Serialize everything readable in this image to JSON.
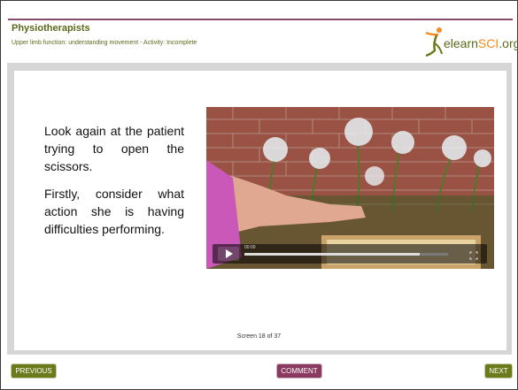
{
  "header": {
    "course_title": "Physiotherapists",
    "module_line": "Upper limb function: understanding movement - Activity: Incomplete",
    "logo": {
      "text_main": "elearn",
      "text_accent": "SCI",
      "text_suffix": ".org",
      "icon": "running-figure-logo-icon"
    }
  },
  "content": {
    "paragraphs": [
      "Look again at the patient trying to open the scissors.",
      "Firstly, consider what action she is having difficulties performing."
    ],
    "video": {
      "time_label": "00:00",
      "progress": 0.86,
      "play_icon": "play-icon",
      "fullscreen_icon": "fullscreen-icon"
    },
    "screen_count": "Screen 18 of 37"
  },
  "nav": {
    "previous_label": "PREVIOUS",
    "comment_label": "COMMENT",
    "next_label": "NEXT"
  },
  "colors": {
    "brand_green": "#6b7a1a",
    "brand_purple": "#8a3a5e",
    "accent_orange": "#f28c1e"
  }
}
